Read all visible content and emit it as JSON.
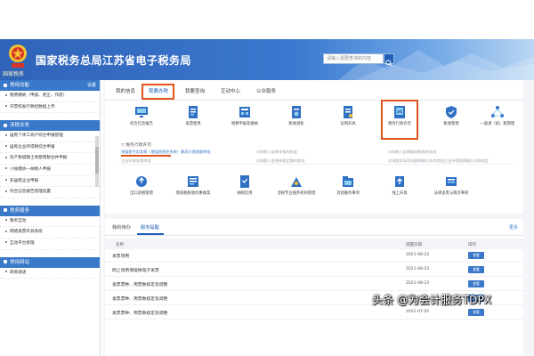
{
  "header": {
    "title": "国家税务总局江苏省电子税务局",
    "emblem_text": "国家税务",
    "search_placeholder": "请输入需要查询的内容"
  },
  "sidebar": {
    "sections": [
      {
        "title": "常用功能",
        "action": "设置",
        "items": [
          "税费缴纳（申报、更正、作废）",
          "开票和发行税控数据上传"
        ]
      },
      {
        "title": "涉税业务",
        "items": [
          "居民个体工商户综合申报管理",
          "居民企业所得税综合申报",
          "房产税城镇土地使用税合并申报",
          "小规模统一纳税人申报",
          "非居民企业申报",
          "综合信息报告管理设置"
        ]
      },
      {
        "title": "税务服务",
        "items": [
          "税务互动",
          "网络发票开具系统",
          "互动平台管理"
        ]
      },
      {
        "title": "常用网站",
        "items": [
          "政策速递"
        ]
      }
    ]
  },
  "tabs": [
    "我的信息",
    "我要办税",
    "我要查询",
    "互动中心",
    "公众服务"
  ],
  "functions_row1": [
    "综合信息报告",
    "发票使用",
    "税费申报及缴纳",
    "税收减免",
    "证明开具",
    "税务行政许可",
    "税收管理",
    "一般退（抵）税管理"
  ],
  "sub_section": {
    "title": "税务行政许可",
    "links": [
      {
        "text": "增值税专用发票（增值税税控系统）最高开票限额审批",
        "style": "blue"
      },
      {
        "text": "对纳税人延期申报的核准",
        "style": "gray"
      },
      {
        "text": "对纳税人延期缴纳税款的核准",
        "style": "gray"
      },
      {
        "text": "企业印制发票审批",
        "style": "gray"
      },
      {
        "text": "对纳税人变更纳税定额的核准",
        "style": "gray"
      },
      {
        "text": "对采取实际利润额预缴以外的其他企业所得税预缴方式的核定",
        "style": "gray"
      }
    ]
  },
  "functions_row2": [
    "出口退税管理",
    "增值税税收优惠备案",
    "纳税信用",
    "涉税专业服务机构管理",
    "其他服务事项",
    "线上开具",
    "法律追责与救济事项"
  ],
  "notice": {
    "tabs": [
      "我的待办",
      "服务提醒"
    ],
    "more": "更多",
    "headers": [
      "名称",
      "提醒日期",
      "操作"
    ],
    "rows": [
      {
        "title": "发票领用",
        "date": "2021-08-23",
        "action": "查看"
      },
      {
        "title": "网上领用增值税电子发票",
        "date": "2021-08-23",
        "action": "查看"
      },
      {
        "title": "发票票种、用票数核定及调整",
        "date": "2021-08-23",
        "action": "查看"
      },
      {
        "title": "发票票种、用票数核定及调整",
        "date": "2021-07-01",
        "action": "查看"
      },
      {
        "title": "发票票种、用票数核定及调整",
        "date": "2021-07-05",
        "action": "查看"
      }
    ]
  },
  "watermark": "头条 @为会计服务TDPX",
  "colors": {
    "brand_blue": "#1f5fb7",
    "highlight_red": "#e2551e",
    "header_blue": "#3b78cf"
  }
}
